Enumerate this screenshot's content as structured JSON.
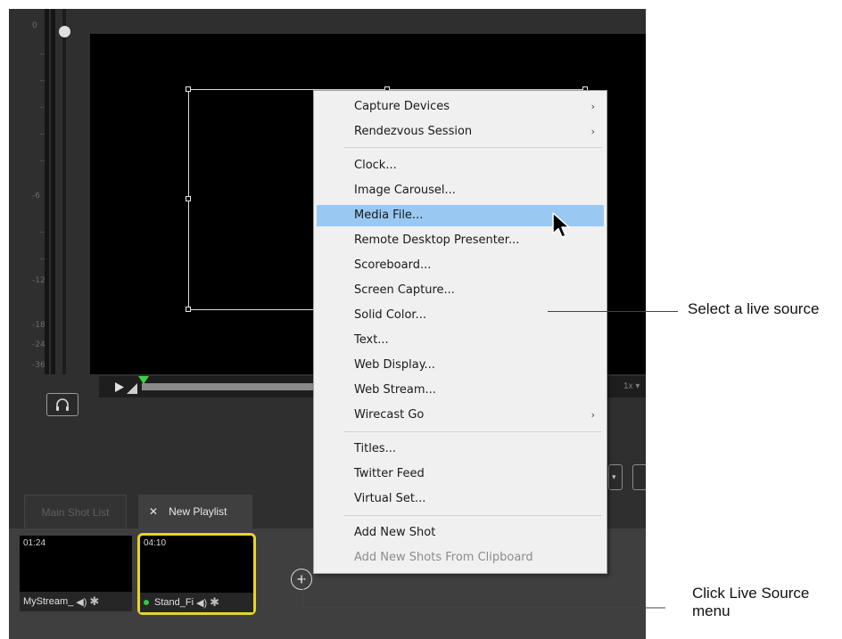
{
  "meter": {
    "labels": [
      "0",
      "-6",
      "-12",
      "-18",
      "-24",
      "-36"
    ]
  },
  "transport": {
    "speed": "1x"
  },
  "tabs": [
    {
      "label": "Main Shot List"
    },
    {
      "label": "New Playlist",
      "close": "✕"
    }
  ],
  "shots": [
    {
      "time": "01:24",
      "name": "MyStream_"
    },
    {
      "time": "04:10",
      "name": "Stand_Fi"
    }
  ],
  "add_button": "+",
  "menu": {
    "items": [
      {
        "label": "Capture Devices",
        "submenu": "›"
      },
      {
        "label": "Rendezvous Session",
        "submenu": "›"
      },
      {
        "label": "Clock..."
      },
      {
        "label": "Image Carousel..."
      },
      {
        "label": "Media File..."
      },
      {
        "label": "Remote Desktop Presenter..."
      },
      {
        "label": "Scoreboard..."
      },
      {
        "label": "Screen Capture..."
      },
      {
        "label": "Solid Color..."
      },
      {
        "label": "Text..."
      },
      {
        "label": "Web Display..."
      },
      {
        "label": "Web Stream..."
      },
      {
        "label": "Wirecast Go",
        "submenu": "›"
      },
      {
        "label": "Titles..."
      },
      {
        "label": "Twitter Feed"
      },
      {
        "label": "Virtual Set..."
      },
      {
        "label": "Add New Shot"
      },
      {
        "label": "Add New Shots From Clipboard"
      }
    ],
    "highlighted": "Media File..."
  },
  "callouts": {
    "select_live_source": "Select a live source",
    "click_live_source_menu": "Click Live Source menu"
  },
  "colors": {
    "app_bg": "#2f2f2f",
    "menu_highlight": "#99c9f3",
    "selected_shot_border": "#e6d52a",
    "playhead": "#3fd13f",
    "live_dot": "#2ecc40"
  }
}
